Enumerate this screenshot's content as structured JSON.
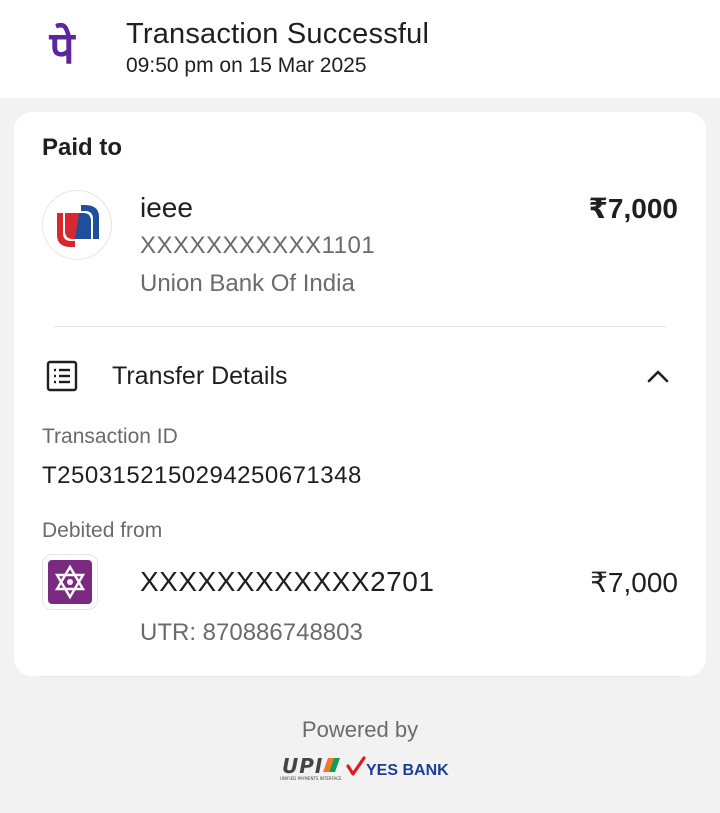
{
  "header": {
    "app_logo_glyph": "पे",
    "title": "Transaction Successful",
    "timestamp": "09:50 pm on 15 Mar 2025"
  },
  "paid_to": {
    "label": "Paid to",
    "name": "ieee",
    "account": "XXXXXXXXXXX1101",
    "bank": "Union Bank Of India",
    "amount": "₹7,000",
    "logo_icon": "union-bank-logo-icon"
  },
  "transfer_details": {
    "title": "Transfer Details",
    "icon": "receipt-list-icon",
    "toggle_icon": "chevron-up-icon",
    "transaction_id_label": "Transaction ID",
    "transaction_id": "T2503152150294250671348",
    "debited_from_label": "Debited from",
    "debit_account": "XXXXXXXXXXXX2701",
    "debit_amount": "₹7,000",
    "utr": "UTR: 870886748803",
    "debit_logo_icon": "star-of-david-bank-icon"
  },
  "footer": {
    "powered_by": "Powered by",
    "upi_logo_text": "UPI",
    "upi_tagline": "UNIFIED PAYMENTS INTERFACE",
    "partner_bank": "YES BANK"
  },
  "colors": {
    "brand_purple": "#5f259f",
    "union_red": "#d7282f",
    "union_blue": "#1d4f9c",
    "yes_blue": "#1c3f94",
    "yes_red": "#e11b22",
    "debit_logo_bg": "#7b2a82"
  }
}
